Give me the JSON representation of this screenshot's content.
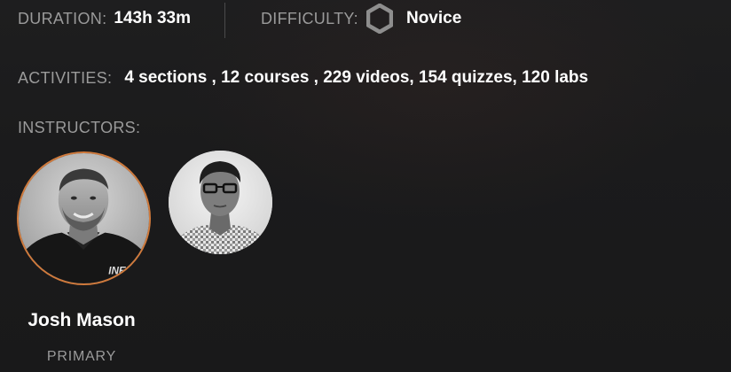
{
  "duration": {
    "label": "DURATION:",
    "value": "143h 33m"
  },
  "difficulty": {
    "label": "DIFFICULTY:",
    "icon": "hexagon-icon",
    "value": "Novice"
  },
  "activities": {
    "label": "ACTIVITIES:",
    "value": "4 sections , 12 courses , 229 videos, 154 quizzes, 120 labs"
  },
  "instructors": {
    "label": "INSTRUCTORS:",
    "list": [
      {
        "name": "Josh Mason",
        "role": "PRIMARY",
        "avatar": "avatar-photo",
        "shirt_logo": "INE",
        "highlight_color": "#d07a3c"
      },
      {
        "avatar": "avatar-photo"
      }
    ]
  },
  "colors": {
    "label": "#9a9a9a",
    "value": "#ffffff",
    "accent": "#d07a3c",
    "background": "#1c1c1d"
  }
}
